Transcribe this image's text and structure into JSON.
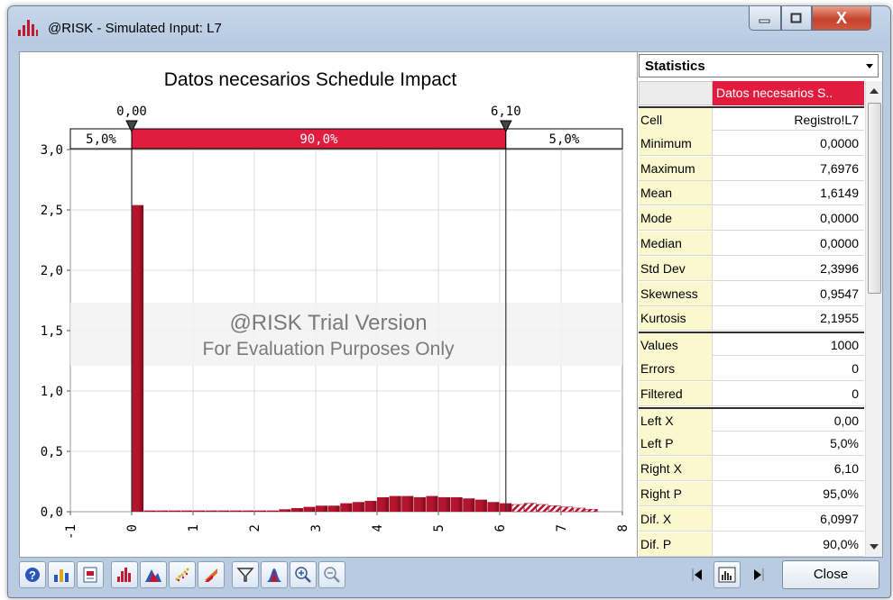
{
  "window": {
    "title": "@RISK - Simulated Input: L7",
    "close_label": "Close",
    "close_glyph": "X"
  },
  "chart_data": {
    "type": "bar",
    "title": "Datos necesarios Schedule Impact",
    "xlabel": "",
    "ylabel": "",
    "x_ticks": [
      "-1",
      "0",
      "1",
      "2",
      "3",
      "4",
      "5",
      "6",
      "7",
      "8"
    ],
    "y_ticks": [
      "0,0",
      "0,5",
      "1,0",
      "1,5",
      "2,0",
      "2,5",
      "3,0"
    ],
    "xlim": [
      -1,
      8
    ],
    "ylim": [
      0,
      3
    ],
    "bin_width": 0.2,
    "bins": [
      {
        "x0": 0.0,
        "y": 2.54
      },
      {
        "x0": 0.2,
        "y": 0.01
      },
      {
        "x0": 0.4,
        "y": 0.01
      },
      {
        "x0": 0.6,
        "y": 0.01
      },
      {
        "x0": 0.8,
        "y": 0.01
      },
      {
        "x0": 1.0,
        "y": 0.01
      },
      {
        "x0": 1.2,
        "y": 0.01
      },
      {
        "x0": 1.4,
        "y": 0.01
      },
      {
        "x0": 1.6,
        "y": 0.01
      },
      {
        "x0": 1.8,
        "y": 0.01
      },
      {
        "x0": 2.0,
        "y": 0.01
      },
      {
        "x0": 2.2,
        "y": 0.01
      },
      {
        "x0": 2.4,
        "y": 0.02
      },
      {
        "x0": 2.6,
        "y": 0.03
      },
      {
        "x0": 2.8,
        "y": 0.04
      },
      {
        "x0": 3.0,
        "y": 0.05
      },
      {
        "x0": 3.2,
        "y": 0.05
      },
      {
        "x0": 3.4,
        "y": 0.07
      },
      {
        "x0": 3.6,
        "y": 0.08
      },
      {
        "x0": 3.8,
        "y": 0.09
      },
      {
        "x0": 4.0,
        "y": 0.12
      },
      {
        "x0": 4.2,
        "y": 0.13
      },
      {
        "x0": 4.4,
        "y": 0.13
      },
      {
        "x0": 4.6,
        "y": 0.12
      },
      {
        "x0": 4.8,
        "y": 0.13
      },
      {
        "x0": 5.0,
        "y": 0.12
      },
      {
        "x0": 5.2,
        "y": 0.12
      },
      {
        "x0": 5.4,
        "y": 0.11
      },
      {
        "x0": 5.6,
        "y": 0.1
      },
      {
        "x0": 5.8,
        "y": 0.08
      },
      {
        "x0": 6.0,
        "y": 0.07
      },
      {
        "x0": 6.2,
        "y": 0.06
      },
      {
        "x0": 6.4,
        "y": 0.07
      },
      {
        "x0": 6.6,
        "y": 0.06
      },
      {
        "x0": 6.8,
        "y": 0.05
      },
      {
        "x0": 7.0,
        "y": 0.04
      },
      {
        "x0": 7.2,
        "y": 0.03
      },
      {
        "x0": 7.4,
        "y": 0.02
      }
    ],
    "delimiters": {
      "left": {
        "x": 0.0,
        "label": "0,00"
      },
      "right": {
        "x": 6.1,
        "label": "6,10"
      },
      "left_pct": "5,0%",
      "middle_pct": "90,0%",
      "right_pct": "5,0%"
    },
    "watermark": {
      "line1": "@RISK Trial Version",
      "line2": "For Evaluation Purposes Only"
    },
    "colors": {
      "bar": "#b3142e",
      "bar_dark": "#7e0a1c",
      "band": "#e01d3e",
      "grid": "#dcdcdc"
    },
    "grid": true
  },
  "stats": {
    "header": "Statistics",
    "column_name": "Datos necesarios S..",
    "rows": [
      {
        "label": "Cell",
        "value": "Registro!L7"
      },
      {
        "label": "Minimum",
        "value": "0,0000"
      },
      {
        "label": "Maximum",
        "value": "7,6976"
      },
      {
        "label": "Mean",
        "value": "1,6149"
      },
      {
        "label": "Mode",
        "value": "0,0000"
      },
      {
        "label": "Median",
        "value": "0,0000"
      },
      {
        "label": "Std Dev",
        "value": "2,3996"
      },
      {
        "label": "Skewness",
        "value": "0,9547"
      },
      {
        "label": "Kurtosis",
        "value": "2,1955"
      },
      {
        "label": "Values",
        "value": "1000"
      },
      {
        "label": "Errors",
        "value": "0"
      },
      {
        "label": "Filtered",
        "value": "0"
      },
      {
        "label": "Left X",
        "value": "0,00"
      },
      {
        "label": "Left P",
        "value": "5,0%"
      },
      {
        "label": "Right X",
        "value": "6,10"
      },
      {
        "label": "Right P",
        "value": "95,0%"
      },
      {
        "label": "Dif. X",
        "value": "6,0997"
      },
      {
        "label": "Dif. P",
        "value": "90,0%"
      }
    ]
  },
  "toolbar": {
    "icons": [
      "help-icon",
      "graph-options-icon",
      "report-icon",
      "histogram-icon",
      "density-icon",
      "scatter-icon",
      "tornado-icon",
      "filter-icon",
      "bell-curve-icon",
      "zoom-in-icon",
      "zoom-out-icon"
    ]
  }
}
